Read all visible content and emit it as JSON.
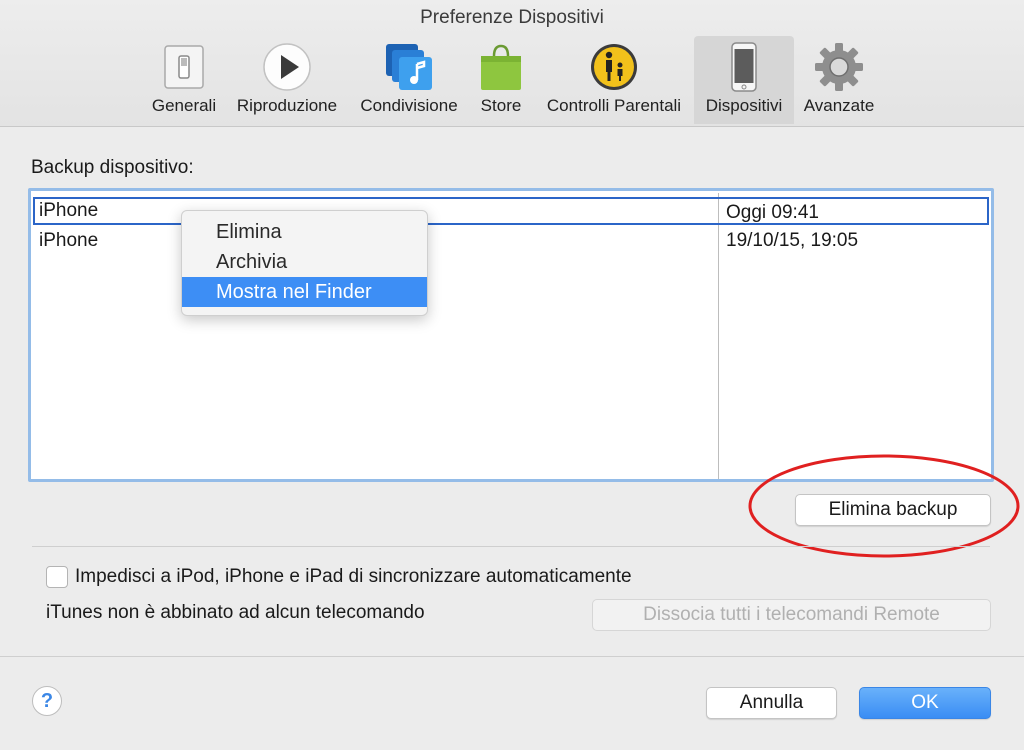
{
  "window": {
    "title": "Preferenze Dispositivi"
  },
  "toolbar": {
    "tabs": [
      {
        "label": "Generali",
        "icon": "switch-icon"
      },
      {
        "label": "Riproduzione",
        "icon": "play-icon"
      },
      {
        "label": "Condivisione",
        "icon": "sharing-music-icon"
      },
      {
        "label": "Store",
        "icon": "shopping-bag-icon"
      },
      {
        "label": "Controlli Parentali",
        "icon": "parental-controls-icon"
      },
      {
        "label": "Dispositivi",
        "icon": "iphone-icon",
        "active": true
      },
      {
        "label": "Avanzate",
        "icon": "gear-icon"
      }
    ]
  },
  "backup": {
    "title": "Backup dispositivo:",
    "rows": [
      {
        "name": "iPhone",
        "date": "Oggi 09:41",
        "selected": true
      },
      {
        "name": "iPhone",
        "date": "19/10/15, 19:05"
      }
    ],
    "delete_button": "Elimina backup"
  },
  "context_menu": {
    "items": [
      {
        "label": "Elimina"
      },
      {
        "label": "Archivia"
      },
      {
        "label": "Mostra nel Finder",
        "highlighted": true
      }
    ]
  },
  "options": {
    "prevent_sync_label": "Impedisci a iPod, iPhone e iPad di sincronizzare automaticamente",
    "prevent_sync_checked": false,
    "remote_status": "iTunes non è abbinato ad alcun telecomando",
    "dissociate_button": "Dissocia tutti i telecomandi Remote"
  },
  "footer": {
    "help": "?",
    "cancel": "Annulla",
    "ok": "OK"
  },
  "colors": {
    "accent": "#3d8ef5",
    "selection_border": "#2b65c8",
    "annotation": "#e02020"
  }
}
